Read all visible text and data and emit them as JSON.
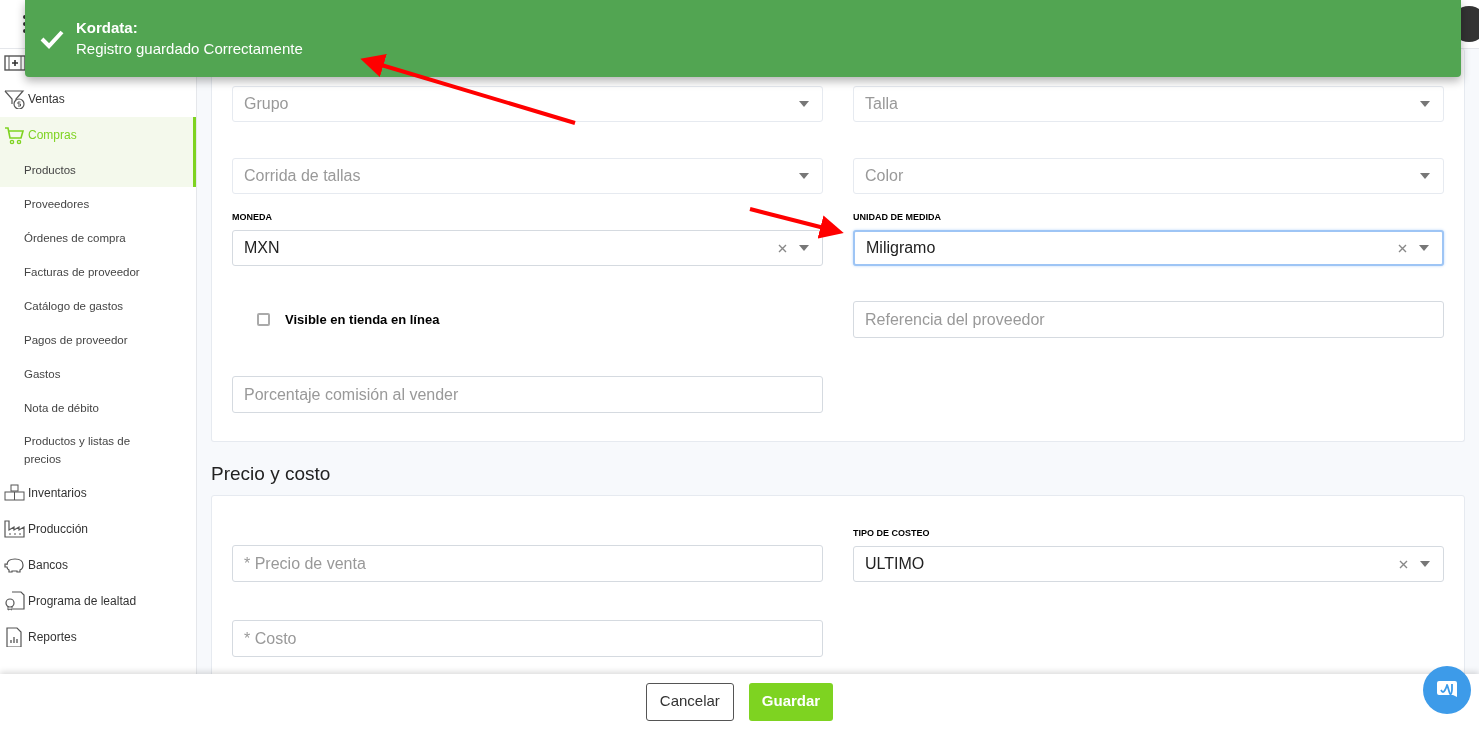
{
  "toast": {
    "title": "Kordata:",
    "message": "Registro guardado Correctamente"
  },
  "sidebar": {
    "items": [
      {
        "selected": false
      },
      {
        "label": "Ventas",
        "selected": false
      },
      {
        "label": "Compras",
        "selected": true,
        "expanded": true,
        "children": [
          {
            "label": "Productos",
            "selected": true
          },
          {
            "label": "Proveedores",
            "selected": false
          },
          {
            "label": "Órdenes de compra",
            "selected": false
          },
          {
            "label": "Facturas de proveedor",
            "selected": false
          },
          {
            "label": "Catálogo de gastos",
            "selected": false
          },
          {
            "label": "Pagos de proveedor",
            "selected": false
          },
          {
            "label": "Gastos",
            "selected": false
          },
          {
            "label": "Nota de débito",
            "selected": false
          },
          {
            "label": "Productos y listas de precios",
            "selected": false
          }
        ]
      },
      {
        "label": "Inventarios",
        "selected": false
      },
      {
        "label": "Producción",
        "selected": false
      },
      {
        "label": "Bancos",
        "selected": false
      },
      {
        "label": "Programa de lealtad",
        "selected": false
      },
      {
        "label": "Reportes",
        "selected": false
      }
    ]
  },
  "sections": [
    {
      "rows": [
        {
          "left": {
            "kind": "select",
            "placeholder": "Grupo",
            "focused": false
          },
          "right": {
            "kind": "select",
            "placeholder": "Talla",
            "focused": false
          }
        },
        {
          "left": {
            "kind": "select",
            "placeholder": "Corrida de tallas",
            "focused": false
          },
          "right": {
            "kind": "select",
            "placeholder": "Color",
            "focused": false
          }
        },
        {
          "left": {
            "kind": "select",
            "label": "MONEDA",
            "value": "MXN",
            "focused": false
          },
          "right": {
            "kind": "select",
            "label": "UNIDAD DE MEDIDA",
            "value": "Miligramo",
            "focused": true
          }
        },
        {
          "left": {
            "kind": "checkbox",
            "label": "Visible en tienda en línea",
            "checked": false
          },
          "right": {
            "kind": "input",
            "placeholder": "Referencia del proveedor",
            "focused": false
          }
        },
        {
          "left": {
            "kind": "input",
            "placeholder": "Porcentaje comisión al vender",
            "focused": false
          }
        }
      ]
    },
    {
      "title": "Precio y costo",
      "rows": [
        {
          "left": {
            "kind": "input",
            "placeholder": "* Precio de venta",
            "focused": false
          },
          "right": {
            "kind": "select",
            "label": "TIPO DE COSTEO",
            "value": "ULTIMO",
            "focused": false
          }
        },
        {
          "left": {
            "kind": "input",
            "placeholder": "* Costo",
            "focused": false
          }
        }
      ]
    }
  ],
  "footer": {
    "cancel": "Cancelar",
    "save": "Guardar"
  }
}
